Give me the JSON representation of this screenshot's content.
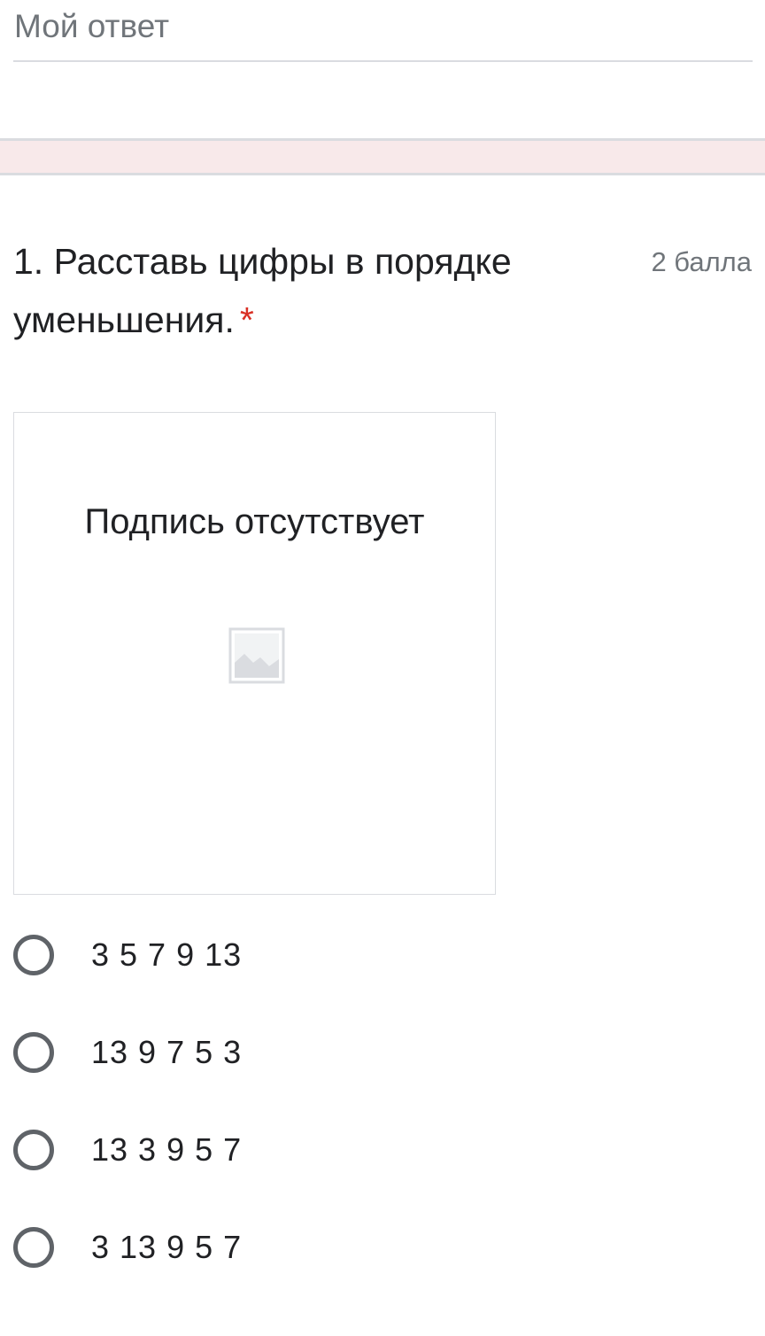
{
  "previous_answer": {
    "placeholder": "Мой ответ"
  },
  "question": {
    "title": "1. Расставь цифры в порядке уменьшения.",
    "required_mark": "*",
    "points": "2 балла"
  },
  "image": {
    "caption": "Подпись отсутствует",
    "icon": "broken-image-icon"
  },
  "options": [
    {
      "label": "3 5 7 9 13",
      "selected": false
    },
    {
      "label": "13 9 7 5 3",
      "selected": false
    },
    {
      "label": "13 3 9 5 7",
      "selected": false
    },
    {
      "label": "3 13 9 5 7",
      "selected": false
    }
  ],
  "colors": {
    "required": "#d93025",
    "section_band": "#f8e9ea",
    "radio_border": "#5f6368"
  }
}
